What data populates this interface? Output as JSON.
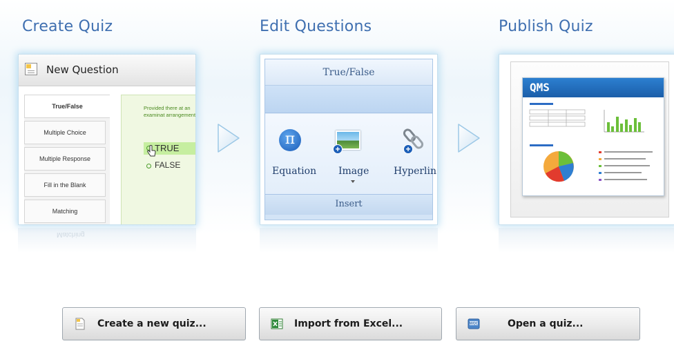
{
  "steps": [
    {
      "title": "Create Quiz"
    },
    {
      "title": "Edit Questions"
    },
    {
      "title": "Publish Quiz"
    }
  ],
  "create_panel": {
    "window_title": "New Question",
    "question_types": [
      "True/False",
      "Multiple Choice",
      "Multiple Response",
      "Fill in the Blank",
      "Matching"
    ],
    "reflection_text": "Matching",
    "question_text": "Provided there at an examinat arrangement?",
    "answer_true": "TRUE",
    "answer_false": "FALSE"
  },
  "edit_panel": {
    "ribbon_header": "True/False",
    "tools": [
      {
        "label": "Equation",
        "icon": "pi-equation-icon"
      },
      {
        "label": "Image",
        "icon": "insert-image-icon"
      },
      {
        "label": "Hyperlin",
        "icon": "hyperlink-icon"
      }
    ],
    "group_label": "Insert"
  },
  "publish_panel": {
    "brand": "QMS"
  },
  "actions": {
    "create": "Create a new quiz...",
    "import": "Import from Excel...",
    "open": "Open a quiz..."
  },
  "colors": {
    "step_title": "#3f6fb0",
    "panel_glow": "#78bee6",
    "qms_bar": "#2c7fd0",
    "true_highlight": "#c6eea0"
  }
}
